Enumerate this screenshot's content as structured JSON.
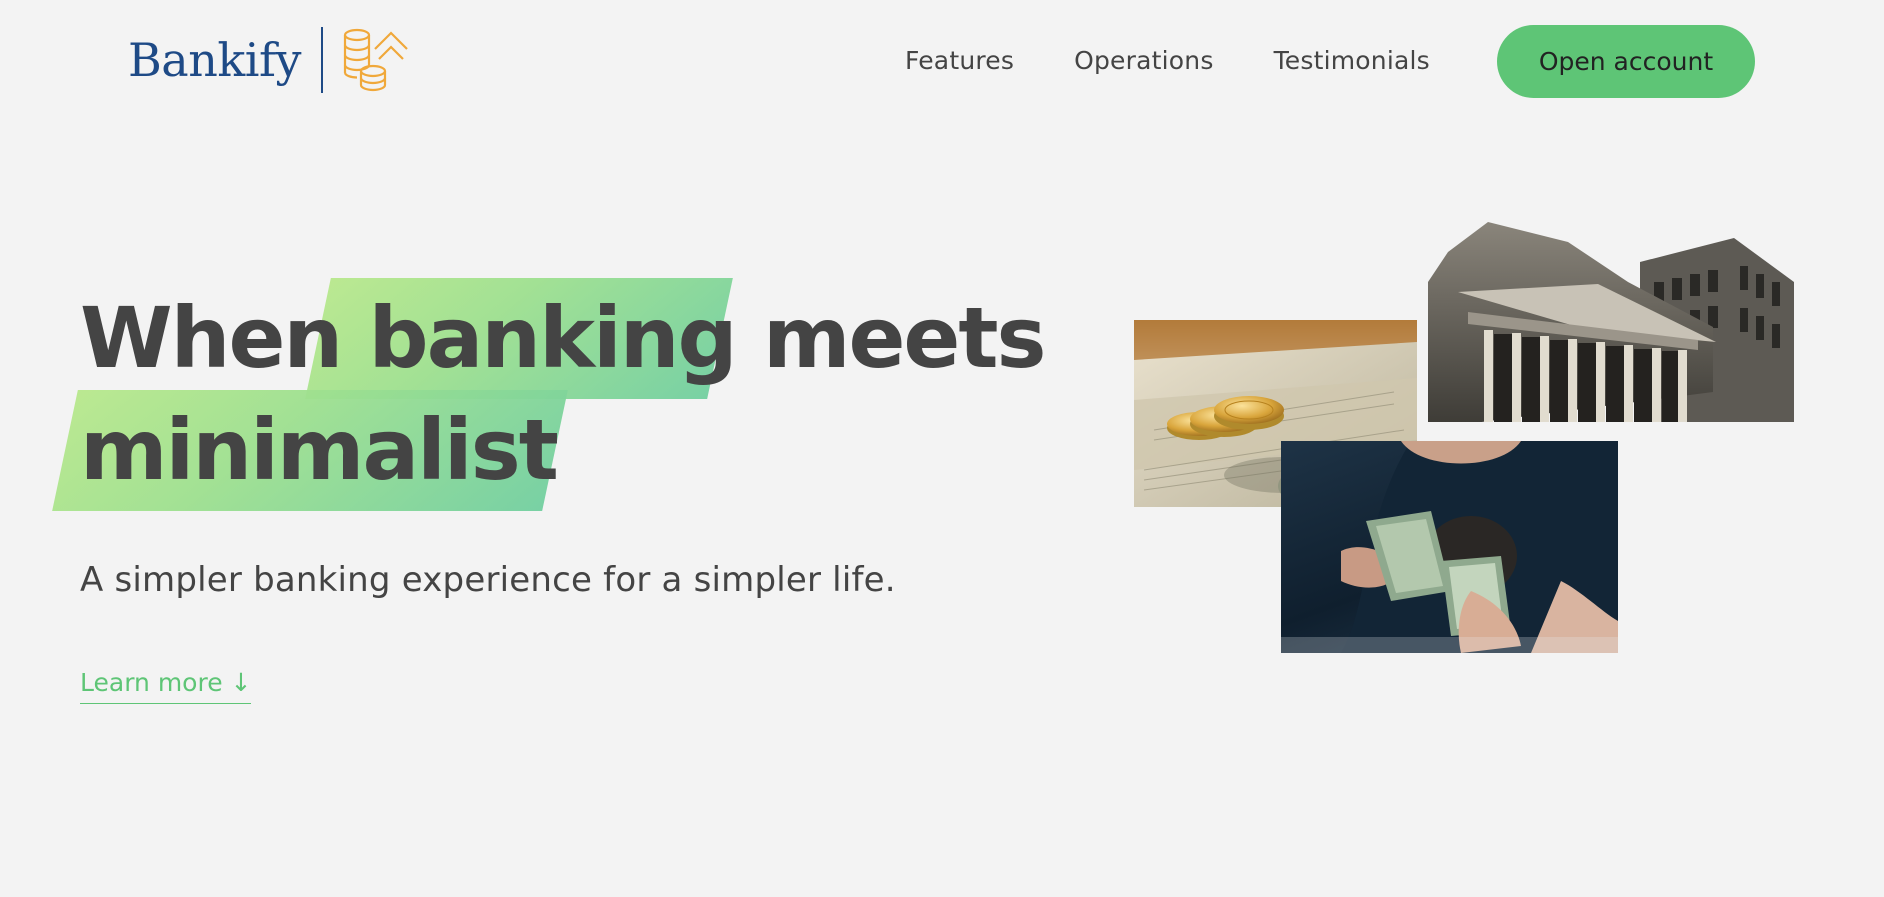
{
  "brand": {
    "name": "Bankify",
    "accent_color": "#5ec576",
    "brand_color": "#1e4a86",
    "logo_icon": "coins-up-arrow-icon"
  },
  "nav": {
    "links": [
      {
        "label": "Features"
      },
      {
        "label": "Operations"
      },
      {
        "label": "Testimonials"
      }
    ],
    "cta_label": "Open account"
  },
  "hero": {
    "title_line1_a": "When",
    "title_line1_highlight": "banking",
    "title_line1_b": "meets",
    "title_line2_highlight": "minimalist",
    "subtitle": "A simpler banking experience for a simpler life.",
    "learn_more": "Learn more ↓"
  },
  "images": [
    {
      "name": "gold-coins-on-banknotes"
    },
    {
      "name": "bank-building"
    },
    {
      "name": "person-counting-cash"
    }
  ]
}
